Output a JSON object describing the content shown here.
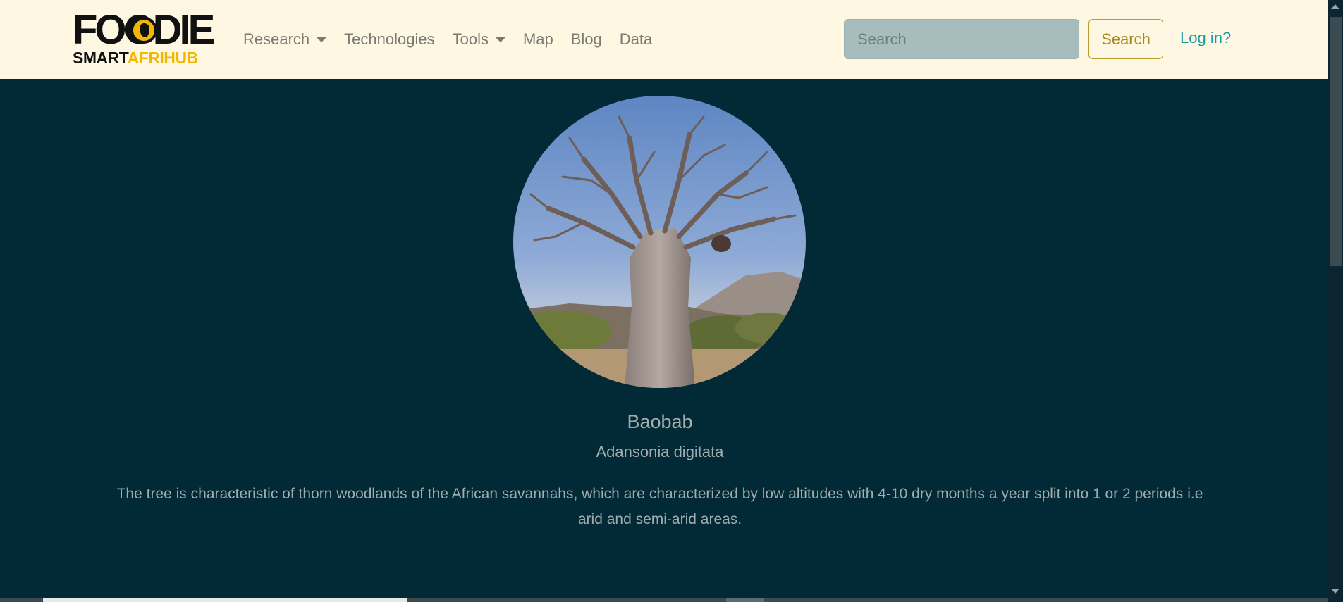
{
  "brand": {
    "logo_top": "FOODIE",
    "logo_bottom_dark": "SMART",
    "logo_bottom_accent": "AFRIHUB",
    "accent_color": "#f2b705"
  },
  "nav": {
    "items": [
      {
        "label": "Research",
        "dropdown": true
      },
      {
        "label": "Technologies",
        "dropdown": false
      },
      {
        "label": "Tools",
        "dropdown": true
      },
      {
        "label": "Map",
        "dropdown": false
      },
      {
        "label": "Blog",
        "dropdown": false
      },
      {
        "label": "Data",
        "dropdown": false
      }
    ]
  },
  "search": {
    "placeholder": "Search",
    "value": "",
    "button_label": "Search"
  },
  "auth": {
    "login_label": "Log in?"
  },
  "plant": {
    "image_icon": "baobab-tree-photo",
    "name": "Baobab",
    "scientific_name": "Adansonia digitata",
    "description": "The tree is characteristic of thorn woodlands of the African savannahs, which are characterized by low altitudes with 4-10 dry months a year split into 1 or 2 periods i.e arid and semi-arid areas."
  },
  "colors": {
    "navbar_bg": "#fef8e3",
    "page_bg": "#022a36",
    "link_teal": "#1a9aa0",
    "button_gold": "#a58a1d"
  }
}
